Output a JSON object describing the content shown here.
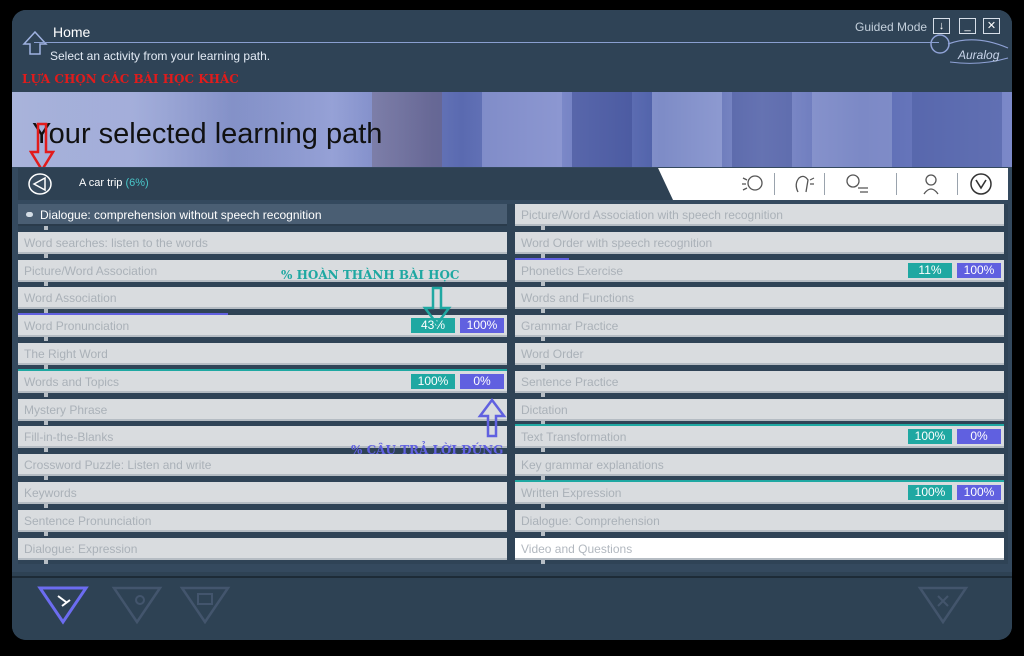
{
  "header": {
    "title": "Home",
    "subtitle": "Select an activity from your learning path.",
    "guided_mode": "Guided Mode",
    "brand": "Auralog",
    "buttons": {
      "download": "↓",
      "minimize": "_",
      "close": "✕"
    }
  },
  "annotations": {
    "other_lessons": "LỰA CHỌN CÁC BÀI HỌC KHÁC",
    "lesson_completion": "% HOÀN THÀNH BÀI HỌC",
    "correct_answers": "% CÂU TRẢ LỜI ĐÚNG"
  },
  "banner": {
    "title": "Your selected learning path"
  },
  "path": {
    "name": "A car trip",
    "progress": "(6%)",
    "skill_icons": [
      "listening-icon",
      "speaking-icon",
      "conversation-icon",
      "writing-icon",
      "grammar-icon"
    ]
  },
  "colors": {
    "score": "#1fa8a2",
    "correct": "#6060e0",
    "annotation_red": "#e21b1b",
    "annotation_teal": "#1fa8a2",
    "annotation_blue": "#6060e0"
  },
  "activities_left": [
    {
      "label": "Dialogue: comprehension without speech recognition",
      "state": "active"
    },
    {
      "label": "Word searches: listen to the words"
    },
    {
      "label": "Picture/Word Association"
    },
    {
      "label": "Word Association"
    },
    {
      "label": "Word Pronunciation",
      "score": "43%",
      "correct": "100%",
      "progress": 0.43
    },
    {
      "label": "The Right Word"
    },
    {
      "label": "Words and Topics",
      "score": "100%",
      "correct": "0%",
      "progress": 1.0
    },
    {
      "label": "Mystery Phrase"
    },
    {
      "label": "Fill-in-the-Blanks"
    },
    {
      "label": "Crossword Puzzle: Listen and write"
    },
    {
      "label": "Keywords"
    },
    {
      "label": "Sentence Pronunciation"
    },
    {
      "label": "Dialogue: Expression"
    }
  ],
  "activities_right": [
    {
      "label": "Picture/Word Association with speech recognition"
    },
    {
      "label": "Word Order with speech recognition"
    },
    {
      "label": "Phonetics Exercise",
      "score": "11%",
      "correct": "100%",
      "progress": 0.11
    },
    {
      "label": "Words and Functions"
    },
    {
      "label": "Grammar Practice"
    },
    {
      "label": "Word Order"
    },
    {
      "label": "Sentence Practice"
    },
    {
      "label": "Dictation"
    },
    {
      "label": "Text Transformation",
      "score": "100%",
      "correct": "0%",
      "progress": 1.0
    },
    {
      "label": "Key grammar explanations"
    },
    {
      "label": "Written Expression",
      "score": "100%",
      "correct": "100%",
      "progress": 1.0
    },
    {
      "label": "Dialogue: Comprehension"
    },
    {
      "label": "Video and Questions",
      "state": "white"
    }
  ]
}
